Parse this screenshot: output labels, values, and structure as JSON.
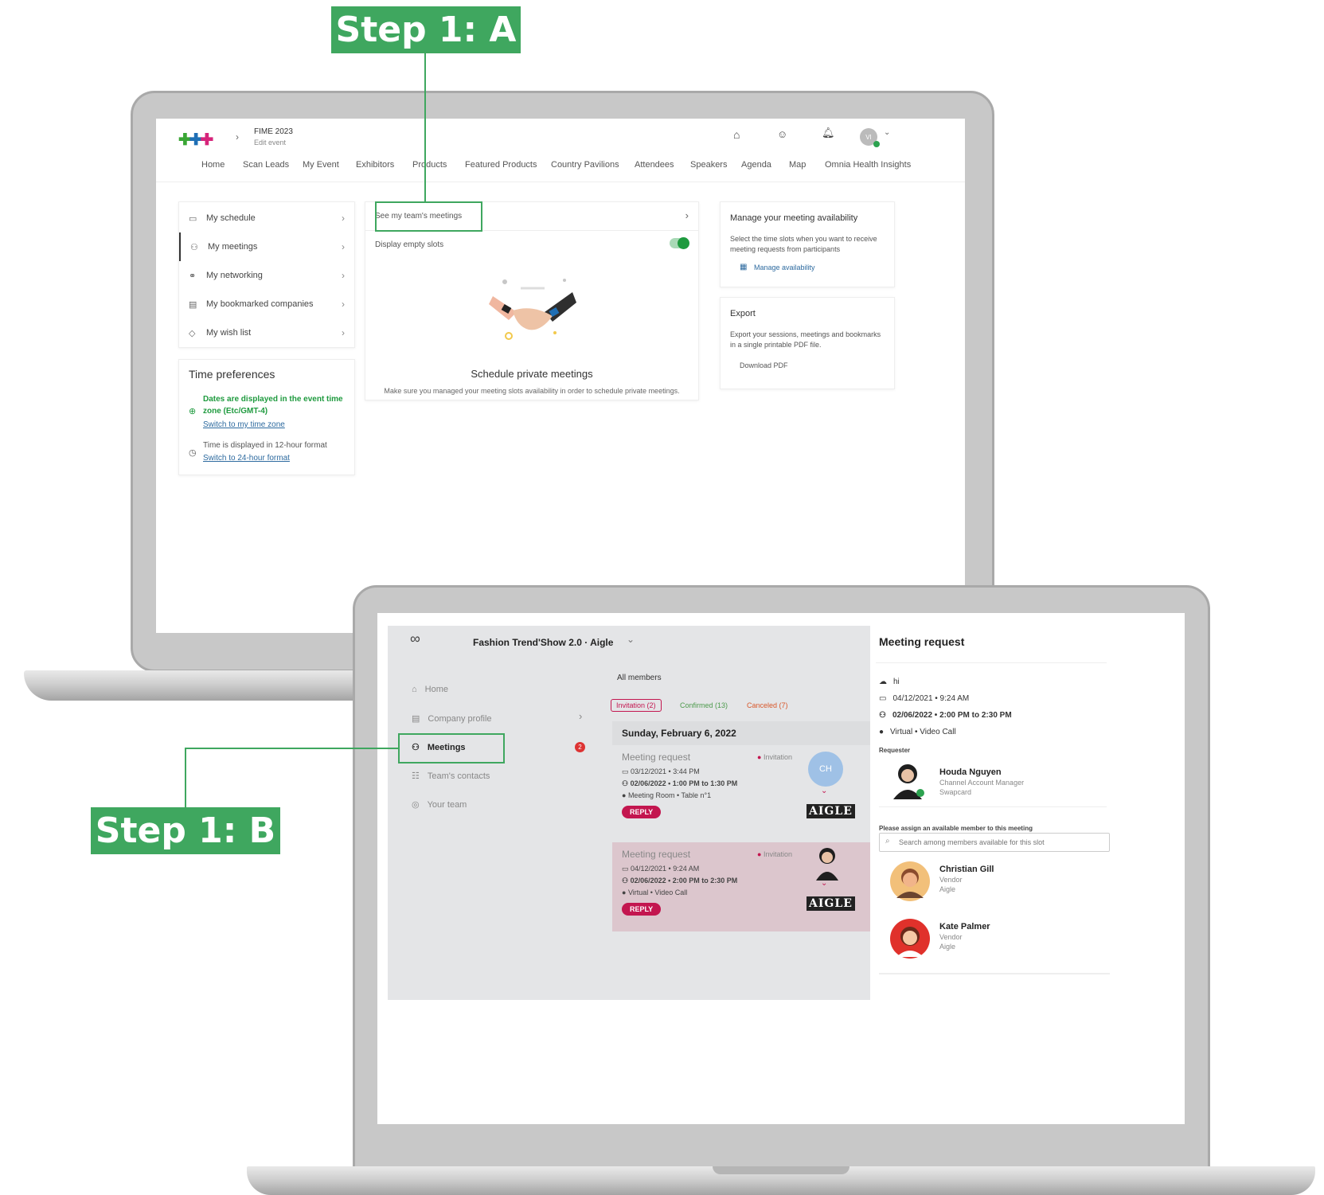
{
  "steps": {
    "a": "Step 1: A",
    "b": "Step 1: B"
  },
  "laptop1": {
    "event_title": "FIME 2023",
    "edit_event": "Edit event",
    "avatar_initials": "VI",
    "nav": [
      "Home",
      "Scan Leads",
      "My Event",
      "Exhibitors",
      "Products",
      "Featured Products",
      "Country Pavilions",
      "Attendees",
      "Speakers",
      "Agenda",
      "Map",
      "Omnia Health Insights"
    ],
    "menu": [
      {
        "label": "My schedule",
        "icon": "calendar-icon"
      },
      {
        "label": "My meetings",
        "icon": "meetings-icon"
      },
      {
        "label": "My networking",
        "icon": "networking-icon"
      },
      {
        "label": "My bookmarked companies",
        "icon": "building-icon"
      },
      {
        "label": "My wish list",
        "icon": "tag-icon"
      }
    ],
    "time_prefs": {
      "title": "Time preferences",
      "tz_text": "Dates are displayed in the event time zone (Etc/GMT-4)",
      "tz_link": "Switch to my time zone",
      "fmt_text": "Time is displayed in 12-hour format",
      "fmt_link": "Switch to 24-hour format"
    },
    "team_meetings": "See my team's meetings",
    "empty_slots": "Display empty slots",
    "empty_title": "Schedule private meetings",
    "empty_desc": "Make sure you managed your meeting slots availability in order to schedule private meetings.",
    "availability": {
      "title": "Manage your meeting availability",
      "desc": "Select the time slots when you want to receive meeting requests from participants",
      "link": "Manage availability"
    },
    "export": {
      "title": "Export",
      "desc": "Export your sessions, meetings and bookmarks in a single printable PDF file.",
      "link": "Download PDF"
    }
  },
  "laptop2": {
    "event_title": "Fashion Trend'Show 2.0 · Aigle",
    "sidebar": [
      {
        "label": "Home",
        "icon": "home-icon"
      },
      {
        "label": "Company profile",
        "icon": "company-icon"
      },
      {
        "label": "Meetings",
        "icon": "meetings-icon"
      },
      {
        "label": "Team's contacts",
        "icon": "contacts-icon"
      },
      {
        "label": "Your team",
        "icon": "team-icon"
      }
    ],
    "meetings_badge": "2",
    "all_members": "All members",
    "filters": {
      "invitation": "Invitation (2)",
      "confirmed": "Confirmed (13)",
      "canceled": "Canceled (7)"
    },
    "date_header": "Sunday, February 6, 2022",
    "meetings": [
      {
        "title": "Meeting request",
        "status": "Invitation",
        "sent": "03/12/2021 • 3:44 PM",
        "when": "02/06/2022 • 1:00 PM to 1:30 PM",
        "where": "Meeting Room • Table n°1",
        "reply": "REPLY",
        "initials": "CH",
        "brand": "AIGLE"
      },
      {
        "title": "Meeting request",
        "status": "Invitation",
        "sent": "04/12/2021 • 9:24 AM",
        "when": "02/06/2022 • 2:00 PM to 2:30 PM",
        "where": "Virtual • Video Call",
        "reply": "REPLY",
        "brand": "AIGLE"
      }
    ],
    "request_panel": {
      "title": "Meeting request",
      "message": "hi",
      "sent": "04/12/2021 • 9:24 AM",
      "when": "02/06/2022 • 2:00 PM to 2:30 PM",
      "where": "Virtual • Video Call",
      "requester_label": "Requester",
      "requester": {
        "name": "Houda Nguyen",
        "role": "Channel Account Manager",
        "company": "Swapcard"
      },
      "assign_label": "Please assign an available member to this meeting",
      "search_placeholder": "Search among members available for this slot",
      "members": [
        {
          "name": "Christian Gill",
          "role": "Vendor",
          "company": "Aigle"
        },
        {
          "name": "Kate Palmer",
          "role": "Vendor",
          "company": "Aigle"
        }
      ]
    }
  },
  "colors": {
    "accent": "#3fa75f",
    "reply": "#c3164f",
    "toggle": "#1e9a3e"
  }
}
